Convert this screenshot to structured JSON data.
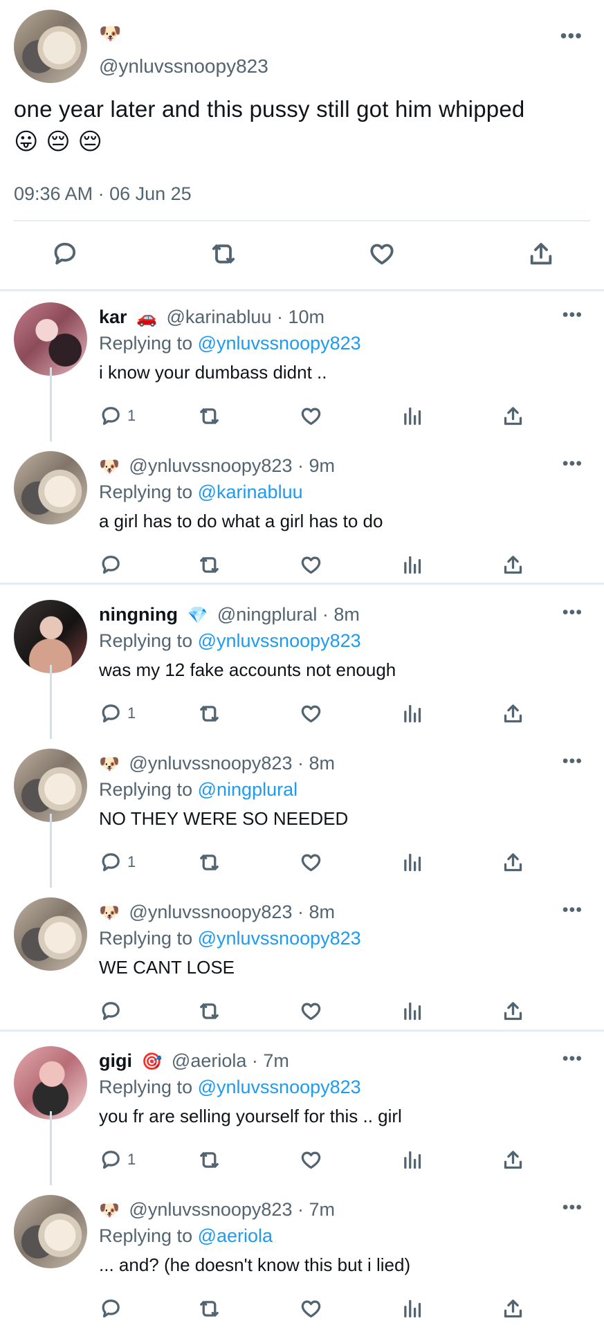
{
  "main": {
    "avatar_alt": "Snoopy plush avatar",
    "name_emoji": "🐶",
    "handle": "@ynluvssnoopy823",
    "more": "•••",
    "text": "one year later and this pussy still got him whipped",
    "emojis": "😛 😔 😔",
    "timestamp": "09:36 AM · 06 Jun 25"
  },
  "replies": [
    {
      "name": "kar",
      "emoji": "🚗",
      "handle": "@karinabluu",
      "time": "10m",
      "replying_label": "Replying to",
      "replying_to": "@ynluvssnoopy823",
      "text": "i know your dumbass didnt ..",
      "reply_count": "1"
    },
    {
      "name": "",
      "emoji": "🐶",
      "handle": "@ynluvssnoopy823",
      "time": "9m",
      "replying_label": "Replying to",
      "replying_to": "@karinabluu",
      "text": "a girl has to do what a girl has to do",
      "reply_count": ""
    },
    {
      "name": "ningning",
      "emoji": "💎",
      "handle": "@ningplural",
      "time": "8m",
      "replying_label": "Replying to",
      "replying_to": "@ynluvssnoopy823",
      "text": "was my 12 fake accounts not enough",
      "reply_count": "1"
    },
    {
      "name": "",
      "emoji": "🐶",
      "handle": "@ynluvssnoopy823",
      "time": "8m",
      "replying_label": "Replying to",
      "replying_to": "@ningplural",
      "text": "NO THEY WERE SO NEEDED",
      "reply_count": "1"
    },
    {
      "name": "",
      "emoji": "🐶",
      "handle": "@ynluvssnoopy823",
      "time": "8m",
      "replying_label": "Replying to",
      "replying_to": "@ynluvssnoopy823",
      "text": "WE CANT LOSE",
      "reply_count": ""
    },
    {
      "name": "gigi",
      "emoji": "🎯",
      "handle": "@aeriola",
      "time": "7m",
      "replying_label": "Replying to",
      "replying_to": "@ynluvssnoopy823",
      "text": "you fr are selling yourself for this .. girl",
      "reply_count": "1"
    },
    {
      "name": "",
      "emoji": "🐶",
      "handle": "@ynluvssnoopy823",
      "time": "7m",
      "replying_label": "Replying to",
      "replying_to": "@aeriola",
      "text": "... and? (he doesn't know this but i lied)",
      "reply_count": ""
    }
  ],
  "colors": {
    "text": "#0f1419",
    "secondary": "#536471",
    "link": "#1d9bf0",
    "divider": "#e7ecef"
  },
  "icons": [
    "comment-icon",
    "retweet-icon",
    "like-icon",
    "analytics-icon",
    "share-icon",
    "more-icon"
  ]
}
